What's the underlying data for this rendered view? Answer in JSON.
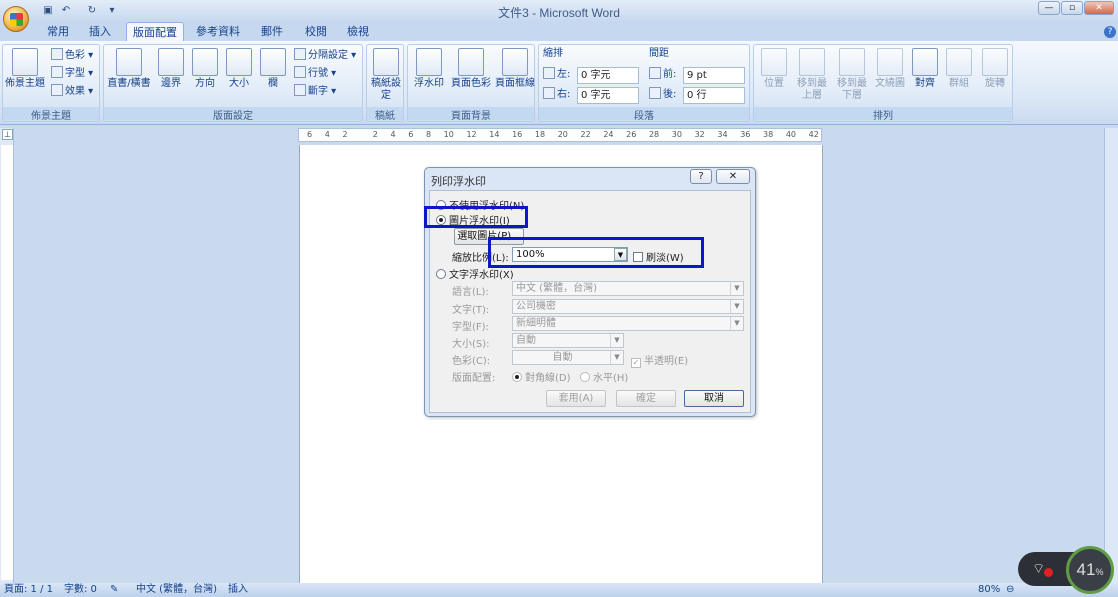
{
  "window": {
    "title": "文件3 - Microsoft Word"
  },
  "tabs": [
    "常用",
    "插入",
    "版面配置",
    "參考資料",
    "郵件",
    "校閱",
    "檢視"
  ],
  "ribbon": {
    "theme_group": {
      "label": "佈景主題",
      "theme_button": "佈景主題",
      "colors": "色彩",
      "fonts": "字型",
      "effects": "效果"
    },
    "page_setup_group": {
      "label": "版面設定",
      "text_direction": "直書/橫書",
      "margins": "邊界",
      "orientation": "方向",
      "size": "大小",
      "columns": "欄",
      "breaks": "分隔設定",
      "line_numbers": "行號",
      "hyphenation": "斷字"
    },
    "manuscript_group": {
      "label": "稿紙",
      "button": "稿紙設定"
    },
    "page_background_group": {
      "label": "頁面背景",
      "watermark": "浮水印",
      "page_color": "頁面色彩",
      "page_borders": "頁面框線"
    },
    "paragraph_group": {
      "label": "段落",
      "indent_title": "縮排",
      "indent_left_label": "左:",
      "indent_left_value": "0 字元",
      "indent_right_label": "右:",
      "indent_right_value": "0 字元",
      "spacing_title": "間距",
      "spacing_before_label": "前:",
      "spacing_before_value": "9 pt",
      "spacing_after_label": "後:",
      "spacing_after_value": "0 行"
    },
    "arrange_group": {
      "label": "排列",
      "position": "位置",
      "bring_forward": "移到最上層",
      "send_backward": "移到最下層",
      "text_wrap": "文繞圖",
      "align": "對齊",
      "group": "群組",
      "rotate": "旋轉"
    }
  },
  "ruler": {
    "ticks": [
      "6",
      "4",
      "2",
      "",
      "2",
      "4",
      "6",
      "8",
      "10",
      "12",
      "14",
      "16",
      "18",
      "20",
      "22",
      "24",
      "26",
      "28",
      "30",
      "32",
      "34",
      "36",
      "38",
      "40",
      "42"
    ]
  },
  "dialog": {
    "title": "列印浮水印",
    "help": "?",
    "close": "✕",
    "no_watermark": "不使用浮水印(N)",
    "picture_watermark": "圖片浮水印(I)",
    "select_picture": "選取圖片(P)...",
    "scale_label": "縮放比例(L):",
    "scale_value": "100%",
    "washout_label": "刷淡(W)",
    "text_watermark": "文字浮水印(X)",
    "language_label": "語言(L):",
    "language_value": "中文 (繁體，台灣)",
    "text_label": "文字(T):",
    "text_value": "公司機密",
    "font_label": "字型(F):",
    "font_value": "新細明體",
    "size_label": "大小(S):",
    "size_value": "自動",
    "color_label": "色彩(C):",
    "color_value": "自動",
    "semitransparent_label": "半透明(E)",
    "layout_label": "版面配置:",
    "diagonal_label": "對角線(D)",
    "horizontal_label": "水平(H)",
    "apply_button": "套用(A)",
    "ok_button": "確定",
    "cancel_button": "取消"
  },
  "statusbar": {
    "page": "頁面: 1 / 1",
    "words": "字數: 0",
    "language": "中文 (繁體，台灣)",
    "mode": "插入",
    "zoom": "80%"
  },
  "overlay": {
    "percent": "41"
  },
  "colors": {
    "highlight": "#0b17c8",
    "ribbon": "#dbe7f6",
    "background": "#c9d9ee"
  }
}
